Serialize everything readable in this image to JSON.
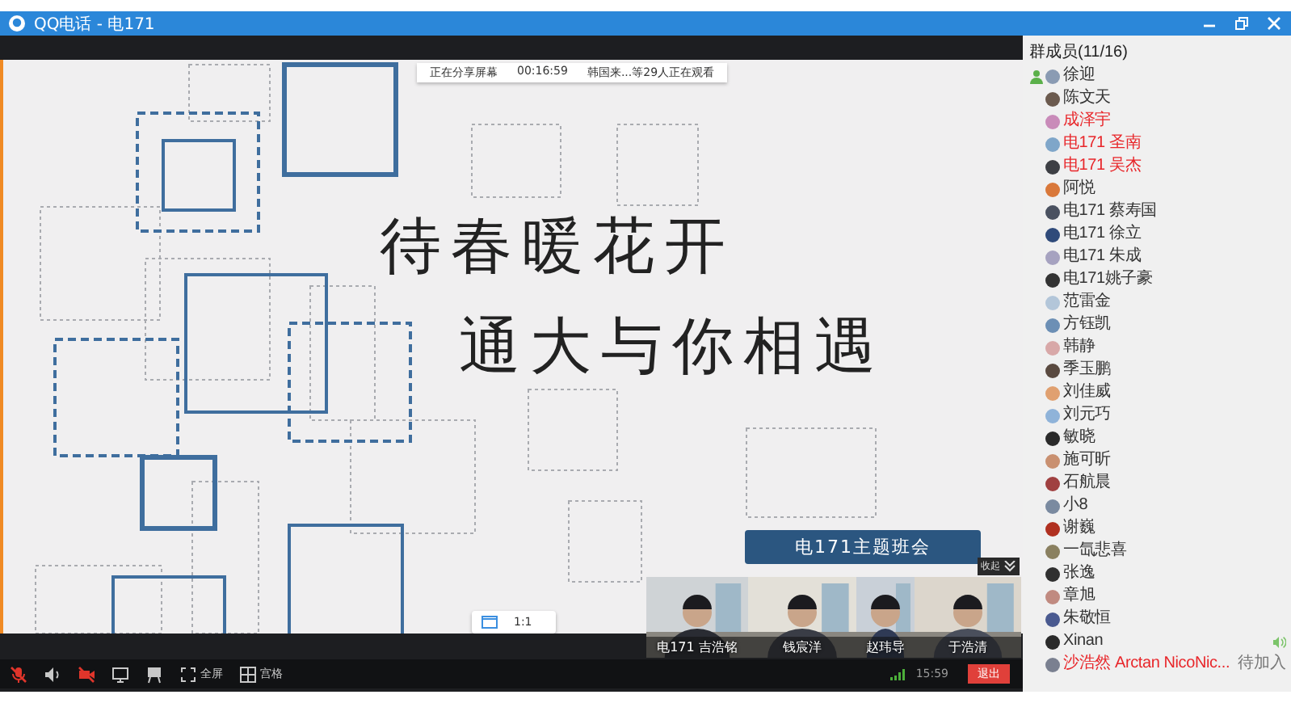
{
  "window": {
    "title": "QQ电话 - 电171"
  },
  "share_notice": {
    "status": "正在分享屏幕",
    "duration": "00:16:59",
    "viewers": "韩国来...等29人正在观看"
  },
  "slide": {
    "lines": [
      "待春暖花开",
      "通大与你相遇"
    ],
    "banner": "电171主题班会"
  },
  "zoom": {
    "label": "1:1"
  },
  "video_strip": {
    "collapse": "收起",
    "tiles": [
      {
        "name": "电171 吉浩铭"
      },
      {
        "name": "钱宸洋"
      },
      {
        "name": "赵玮导"
      },
      {
        "name": "于浩清"
      }
    ]
  },
  "toolbar": {
    "items": [
      {
        "kind": "mic",
        "off": true
      },
      {
        "kind": "speaker",
        "off": false
      },
      {
        "kind": "camera",
        "off": true
      },
      {
        "kind": "screen",
        "off": false
      },
      {
        "kind": "whiteboard",
        "off": false
      },
      {
        "kind": "fullscreen",
        "off": false,
        "label": "全屏"
      },
      {
        "kind": "grid",
        "off": false,
        "label": "宫格"
      }
    ]
  },
  "status": {
    "time": "15:59",
    "exit": "退出"
  },
  "members": {
    "title": "群成员(11/16)",
    "items": [
      {
        "name": "徐迎",
        "color": "#333333",
        "owner": true,
        "speaking": false
      },
      {
        "name": "陈文天",
        "color": "#333333",
        "owner": false,
        "speaking": false
      },
      {
        "name": "成泽宇",
        "color": "#e8262a",
        "owner": false,
        "speaking": false
      },
      {
        "name": "电171 圣南",
        "color": "#e8262a",
        "owner": false,
        "speaking": false
      },
      {
        "name": "电171 吴杰",
        "color": "#e8262a",
        "owner": false,
        "speaking": false
      },
      {
        "name": "阿悦",
        "color": "#333333",
        "owner": false,
        "speaking": false
      },
      {
        "name": "电171 蔡寿国",
        "color": "#333333",
        "owner": false,
        "speaking": false
      },
      {
        "name": "电171 徐立",
        "color": "#333333",
        "owner": false,
        "speaking": false
      },
      {
        "name": "电171 朱成",
        "color": "#333333",
        "owner": false,
        "speaking": false
      },
      {
        "name": "电171姚子豪",
        "color": "#333333",
        "owner": false,
        "speaking": false
      },
      {
        "name": "范雷金",
        "color": "#333333",
        "owner": false,
        "speaking": false
      },
      {
        "name": "方钰凯",
        "color": "#333333",
        "owner": false,
        "speaking": false
      },
      {
        "name": "韩静",
        "color": "#333333",
        "owner": false,
        "speaking": false
      },
      {
        "name": "季玉鹏",
        "color": "#333333",
        "owner": false,
        "speaking": false
      },
      {
        "name": "刘佳威",
        "color": "#333333",
        "owner": false,
        "speaking": false
      },
      {
        "name": "刘元巧",
        "color": "#333333",
        "owner": false,
        "speaking": false
      },
      {
        "name": "敏晓",
        "color": "#333333",
        "owner": false,
        "speaking": false
      },
      {
        "name": "施可昕",
        "color": "#333333",
        "owner": false,
        "speaking": false
      },
      {
        "name": "石航晨",
        "color": "#333333",
        "owner": false,
        "speaking": false
      },
      {
        "name": "小8",
        "color": "#333333",
        "owner": false,
        "speaking": false
      },
      {
        "name": "谢巍",
        "color": "#333333",
        "owner": false,
        "speaking": false
      },
      {
        "name": "一氙悲喜",
        "color": "#333333",
        "owner": false,
        "speaking": false
      },
      {
        "name": "张逸",
        "color": "#333333",
        "owner": false,
        "speaking": false
      },
      {
        "name": "章旭",
        "color": "#333333",
        "owner": false,
        "speaking": false
      },
      {
        "name": "朱敬恒",
        "color": "#333333",
        "owner": false,
        "speaking": false
      },
      {
        "name": "Xinan",
        "color": "#333333",
        "owner": false,
        "speaking": true
      },
      {
        "name": "沙浩然 Arctan NicoNic...",
        "color": "#e8262a",
        "owner": false,
        "speaking": false,
        "status": "待加入"
      }
    ]
  }
}
